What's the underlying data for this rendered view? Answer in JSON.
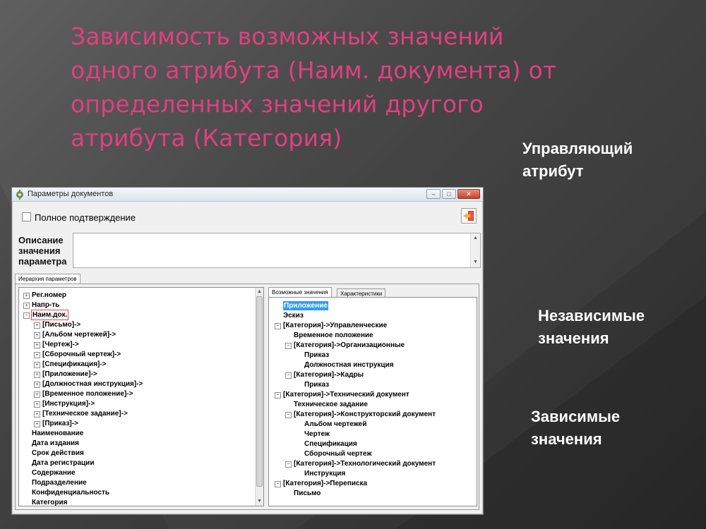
{
  "slide": {
    "title_lines": [
      "Зависимость возможных значений",
      "одного атрибута (Наим. документа) от",
      "определенных значений другого",
      "атрибута (Категория)"
    ],
    "callouts": {
      "controlling": [
        "Управляющий",
        "атрибут"
      ],
      "independent": [
        "Независимые",
        "значения"
      ],
      "dependent": [
        "Зависимые",
        "значения"
      ]
    },
    "title_color": "#e0407e"
  },
  "dialog": {
    "title": "Параметры документов",
    "window_buttons": {
      "minimize": "‒",
      "maximize": "□",
      "close": "✕"
    },
    "full_confirmation_label": "Полное подтверждение",
    "full_confirmation_checked": false,
    "description_label": [
      "Описание",
      "значения",
      "параметра"
    ],
    "description_value": "",
    "outer_tab": "Иерархия параметров",
    "left_tree": [
      {
        "label": "Рег.номер",
        "toggle": "+"
      },
      {
        "label": "Напр-ть",
        "toggle": "+"
      },
      {
        "label": "Наим.док.",
        "toggle": "−"
      },
      {
        "label": "[Письмо]->",
        "toggle": "+"
      },
      {
        "label": "[Альбом чертежей]->",
        "toggle": "+"
      },
      {
        "label": "[Чертеж]->",
        "toggle": "+"
      },
      {
        "label": "[Сборочный чертеж]->",
        "toggle": "+"
      },
      {
        "label": "[Спецификация]->",
        "toggle": "+"
      },
      {
        "label": "[Приложение]->",
        "toggle": "+"
      },
      {
        "label": "[Должностная инструкция]->",
        "toggle": "+"
      },
      {
        "label": "[Временное положение]->",
        "toggle": "+"
      },
      {
        "label": "[Инструкция]->",
        "toggle": "+"
      },
      {
        "label": "[Техническое задание]->",
        "toggle": "+"
      },
      {
        "label": "[Приказ]->",
        "toggle": "+"
      },
      {
        "label": "Наименование",
        "toggle": ""
      },
      {
        "label": "Дата издания",
        "toggle": ""
      },
      {
        "label": "Срок действия",
        "toggle": ""
      },
      {
        "label": "Дата регистрации",
        "toggle": ""
      },
      {
        "label": "Содержание",
        "toggle": ""
      },
      {
        "label": "Подразделение",
        "toggle": ""
      },
      {
        "label": "Конфиденциальность",
        "toggle": ""
      },
      {
        "label": "Категория",
        "toggle": ""
      }
    ],
    "inner_tabs": [
      "Возможные значения",
      "Характеристики"
    ],
    "right_tree": [
      {
        "label": "Приложение",
        "toggle": "",
        "selected": true
      },
      {
        "label": "Эскиз",
        "toggle": ""
      },
      {
        "label": "[Категория]->Управленческие",
        "toggle": "−"
      },
      {
        "label": "Временное положение",
        "toggle": ""
      },
      {
        "label": "[Категория]->Организационные",
        "toggle": "−"
      },
      {
        "label": "Приказ",
        "toggle": ""
      },
      {
        "label": "Должностная инструкция",
        "toggle": ""
      },
      {
        "label": "[Категория]->Кадры",
        "toggle": "−"
      },
      {
        "label": "Приказ",
        "toggle": ""
      },
      {
        "label": "[Категория]->Технический документ",
        "toggle": "−"
      },
      {
        "label": "Техническое задание",
        "toggle": ""
      },
      {
        "label": "[Категория]->Конструкторский документ",
        "toggle": "−"
      },
      {
        "label": "Альбом чертежей",
        "toggle": ""
      },
      {
        "label": "Чертеж",
        "toggle": ""
      },
      {
        "label": "Спецификация",
        "toggle": ""
      },
      {
        "label": "Сборочный чертеж",
        "toggle": ""
      },
      {
        "label": "[Категория]->Технологический документ",
        "toggle": "−"
      },
      {
        "label": "Инструкция",
        "toggle": ""
      },
      {
        "label": "[Категория]->Переписка",
        "toggle": "−"
      },
      {
        "label": "Письмо",
        "toggle": ""
      }
    ],
    "icons": {
      "app": "app-gear-icon",
      "exit": "exit-door-icon",
      "checkbox": "checkbox-icon"
    },
    "colors": {
      "selection": "#3399ff",
      "highlight_box": "#e0474c"
    }
  }
}
